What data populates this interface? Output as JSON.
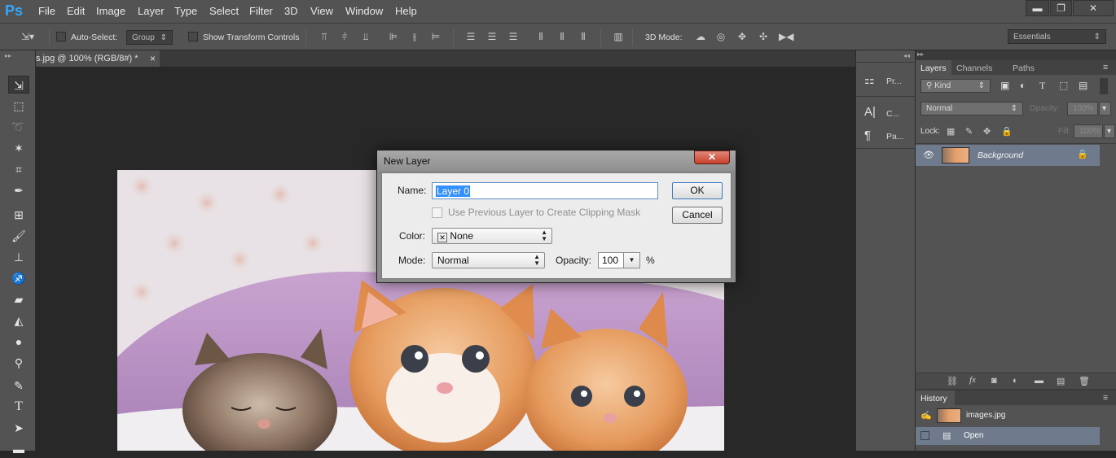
{
  "app": {
    "logo": "Ps"
  },
  "menu": [
    "File",
    "Edit",
    "Image",
    "Layer",
    "Type",
    "Select",
    "Filter",
    "3D",
    "View",
    "Window",
    "Help"
  ],
  "window_controls": {
    "minimize": "▬",
    "restore": "❐",
    "close": "✕"
  },
  "options": {
    "auto_select_label": "Auto-Select:",
    "auto_select_value": "Group",
    "show_transform_label": "Show Transform Controls",
    "mode3d_label": "3D Mode:",
    "workspace": "Essentials"
  },
  "document": {
    "tab_title": "s.jpg @ 100% (RGB/8#) *",
    "close": "×"
  },
  "mini_panel": {
    "items": [
      "Pr...",
      "C...",
      "Pa..."
    ]
  },
  "layers_panel": {
    "tabs": [
      "Layers",
      "Channels",
      "Paths"
    ],
    "filter_kind": "Kind",
    "blend_mode": "Normal",
    "opacity_label": "Opacity:",
    "opacity_value": "100%",
    "lock_label": "Lock:",
    "fill_label": "Fill:",
    "fill_value": "100%",
    "layer_name": "Background"
  },
  "history_panel": {
    "title": "History",
    "items": [
      "images.jpg",
      "Open"
    ]
  },
  "dialog": {
    "title": "New Layer",
    "name_label": "Name:",
    "name_value": "Layer 0",
    "clip_label": "Use Previous Layer to Create Clipping Mask",
    "color_label": "Color:",
    "color_value": "None",
    "mode_label": "Mode:",
    "mode_value": "Normal",
    "opacity_label": "Opacity:",
    "opacity_value": "100",
    "percent": "%",
    "ok": "OK",
    "cancel": "Cancel"
  }
}
